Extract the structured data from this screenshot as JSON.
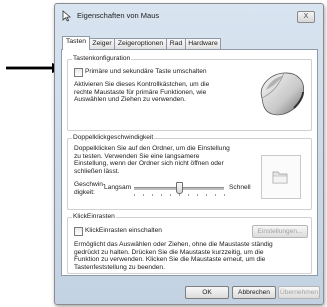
{
  "window": {
    "title": "Eigenschaften von Maus",
    "close_label": "X"
  },
  "tabs": [
    {
      "label": "Tasten",
      "active": true
    },
    {
      "label": "Zeiger",
      "active": false
    },
    {
      "label": "Zeigeroptionen",
      "active": false
    },
    {
      "label": "Rad",
      "active": false
    },
    {
      "label": "Hardware",
      "active": false
    }
  ],
  "button_config": {
    "title": "Tastenkonfiguration",
    "checkbox_label": "Primäre und sekundäre Taste umschalten",
    "checked": false,
    "description": [
      "Aktivieren Sie dieses Kontrollkästchen, um die",
      "rechte Maustaste für primäre Funktionen, wie",
      "Auswählen und Ziehen zu verwenden."
    ]
  },
  "double_click": {
    "title": "Doppelklickgeschwindigkeit",
    "description": [
      "Doppelklicken Sie auf den Ordner, um die Einstellung",
      "zu testen. Verwenden Sie eine langsamere",
      "Einstellung, wenn der Ordner sich nicht öffnen oder",
      "schließen lässt."
    ],
    "speed_label": [
      "Geschwin-",
      "digkeit:"
    ],
    "slow_label": "Langsam",
    "fast_label": "Schnell",
    "slider_value_fraction": 0.5
  },
  "click_lock": {
    "title": "KlickEinrasten",
    "checkbox_label": "KlickEinrasten einschalten",
    "checked": false,
    "settings_button": "Einstellungen...",
    "description": [
      "Ermöglicht das Auswählen oder Ziehen, ohne die Maustaste ständig",
      "gedrückt zu halten. Drücken Sie die Maustaste kurzzeitig, um die",
      "Funktion zu verwenden. Klicken Sie die Maustaste erneut, um die",
      "Tastenfeststellung zu beenden."
    ]
  },
  "footer": {
    "ok": "OK",
    "cancel": "Abbrechen",
    "apply": "Übernehmen"
  }
}
